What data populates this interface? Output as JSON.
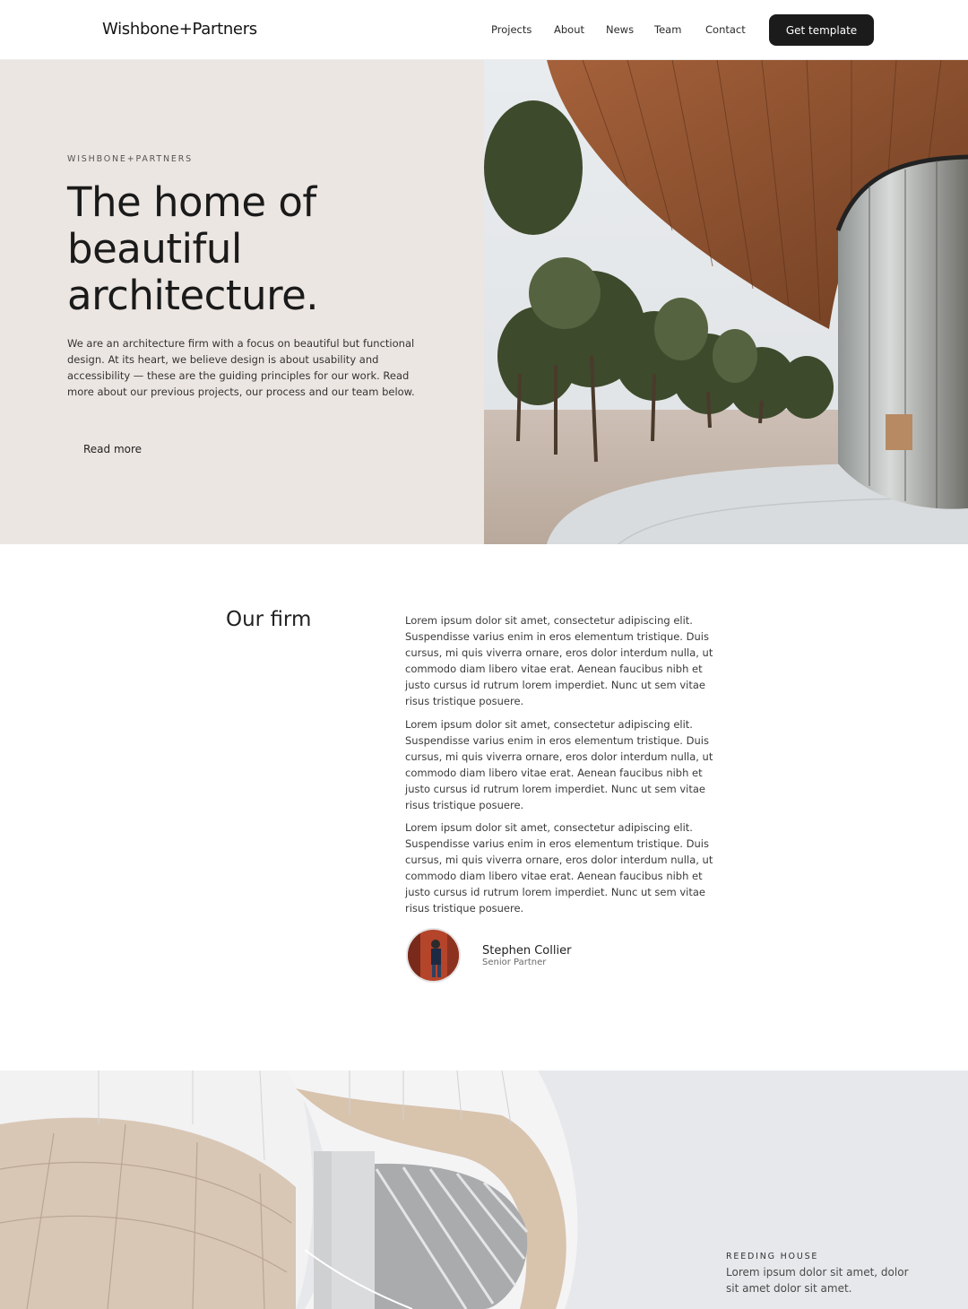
{
  "nav": {
    "logo": "Wishbone+Partners",
    "links": [
      "Projects",
      "About",
      "News",
      "Team",
      "Contact"
    ],
    "cta": "Get template"
  },
  "hero": {
    "eyebrow": "WISHBONE+PARTNERS",
    "title": "The home of beautiful architecture.",
    "body": "We are an architecture firm with a focus on beautiful but functional design. At its heart, we believe design is about usability and accessibility — these are the guiding principles for our work. Read more about our previous projects, our process and our team below.",
    "read_more": "Read more"
  },
  "firm": {
    "title": "Our firm",
    "paragraphs": [
      "Lorem ipsum dolor sit amet, consectetur adipiscing elit. Suspendisse varius enim in eros elementum tristique. Duis cursus, mi quis viverra ornare, eros dolor interdum nulla, ut commodo diam libero vitae erat. Aenean faucibus nibh et justo cursus id rutrum lorem imperdiet. Nunc ut sem vitae risus tristique posuere.",
      "Lorem ipsum dolor sit amet, consectetur adipiscing elit. Suspendisse varius enim in eros elementum tristique. Duis cursus, mi quis viverra ornare, eros dolor interdum nulla, ut commodo diam libero vitae erat. Aenean faucibus nibh et justo cursus id rutrum lorem imperdiet. Nunc ut sem vitae risus tristique posuere.",
      "Lorem ipsum dolor sit amet, consectetur adipiscing elit. Suspendisse varius enim in eros elementum tristique. Duis cursus, mi quis viverra ornare, eros dolor interdum nulla, ut commodo diam libero vitae erat. Aenean faucibus nibh et justo cursus id rutrum lorem imperdiet. Nunc ut sem vitae risus tristique posuere."
    ],
    "person_name": "Stephen Collier",
    "person_role": "Senior Partner"
  },
  "project": {
    "eyebrow": "REEDING HOUSE",
    "body": "Lorem ipsum dolor sit amet, dolor sit amet dolor sit amet."
  },
  "colors": {
    "hero_bg": "#ece6e2",
    "cta_bg": "#1b1b1b",
    "text": "#1f1f1f"
  }
}
